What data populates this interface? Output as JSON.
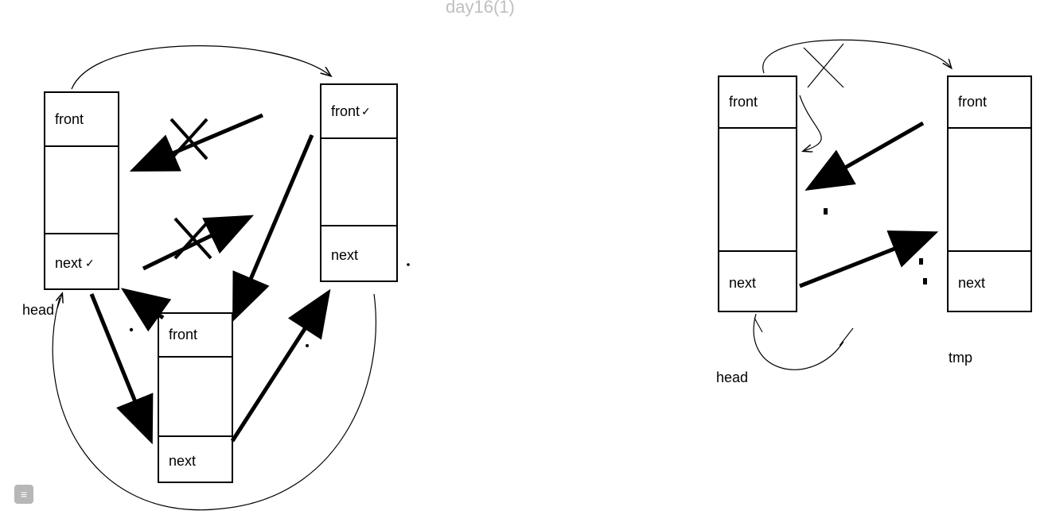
{
  "faint": {
    "tl": "",
    "title": "day16(1)",
    "tr": ""
  },
  "left": {
    "nodeA": {
      "front": "front",
      "next": "next"
    },
    "nodeB": {
      "front": "front",
      "next": "next"
    },
    "nodeC": {
      "front": "front",
      "next": "next"
    },
    "head": "head",
    "checkA": "✓",
    "checkB": "✓"
  },
  "right": {
    "nodeH": {
      "front": "front",
      "next": "next"
    },
    "nodeT": {
      "front": "front",
      "next": "next"
    },
    "head": "head",
    "tmp": "tmp"
  },
  "icons": {
    "sidebar": "≡"
  }
}
